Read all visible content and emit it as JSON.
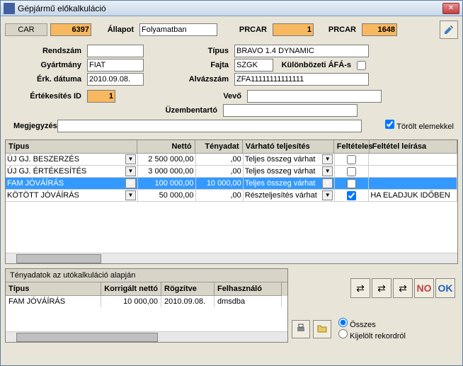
{
  "window": {
    "title": "Gépjármű előkalkuláció"
  },
  "header": {
    "car_label": "CAR",
    "car_value": "6397",
    "allapot_label": "Állapot",
    "allapot_value": "Folyamatban",
    "prcar1_label": "PRCAR",
    "prcar1_value": "1",
    "prcar2_label": "PRCAR",
    "prcar2_value": "1648"
  },
  "form": {
    "rendszam_label": "Rendszám",
    "rendszam_value": "",
    "tipus_label": "Típus",
    "tipus_value": "BRAVO 1.4 DYNAMIC",
    "gyartmany_label": "Gyártmány",
    "gyartmany_value": "FIAT",
    "fajta_label": "Fajta",
    "fajta_value": "SZGK",
    "afa_label": "Különbözeti ÁFÁ-s",
    "erk_label": "Érk. dátuma",
    "erk_value": "2010.09.08.",
    "alvaz_label": "Alvázszám",
    "alvaz_value": "ZFA11111111111111",
    "ertid_label": "Értékesítés ID",
    "ertid_value": "1",
    "vevo_label": "Vevő",
    "vevo_value": "",
    "uzem_label": "Üzembentartó",
    "uzem_value": "",
    "megj_label": "Megjegyzés",
    "megj_value": "",
    "torolt_label": "Törölt elemekkel"
  },
  "grid": {
    "headers": {
      "tipus": "Típus",
      "netto": "Nettó",
      "teny": "Tényadat",
      "varhato": "Várható teljesítés",
      "felt": "Feltételes",
      "feltl": "Feltétel leírása"
    },
    "rows": [
      {
        "tipus": "ÚJ GJ. BESZERZÉS",
        "netto": "2 500 000,00",
        "teny": ",00",
        "varhato": "Teljes összeg várhat",
        "felt": false,
        "feltl": ""
      },
      {
        "tipus": "ÚJ GJ. ÉRTÉKESÍTÉS",
        "netto": "3 000 000,00",
        "teny": ",00",
        "varhato": "Teljes összeg várhat",
        "felt": false,
        "feltl": ""
      },
      {
        "tipus": "FAM JÓVÁÍRÁS",
        "netto": "100 000,00",
        "teny": "10 000,00",
        "varhato": "Teljes összeg várhat",
        "felt": false,
        "feltl": "",
        "selected": true
      },
      {
        "tipus": "KÖTÖTT JÓVÁÍRÁS",
        "netto": "50 000,00",
        "teny": ",00",
        "varhato": "Részteljesítés várhat",
        "felt": true,
        "feltl": "HA ELADJUK IDŐBEN"
      }
    ]
  },
  "subpanel": {
    "title": "Tényadatok az utókalkuláció alapján",
    "headers": {
      "tipus": "Típus",
      "korr": "Korrigált nettó",
      "rog": "Rögzítve",
      "felh": "Felhasználó"
    },
    "rows": [
      {
        "tipus": "FAM JÓVÁÍRÁS",
        "korr": "10 000,00",
        "rog": "2010.09.08.",
        "felh": "dmsdba"
      }
    ]
  },
  "buttons": {
    "no": "NO",
    "ok": "OK"
  },
  "radio": {
    "osszes": "Összes",
    "kijelolt": "Kijelölt rekordról"
  }
}
